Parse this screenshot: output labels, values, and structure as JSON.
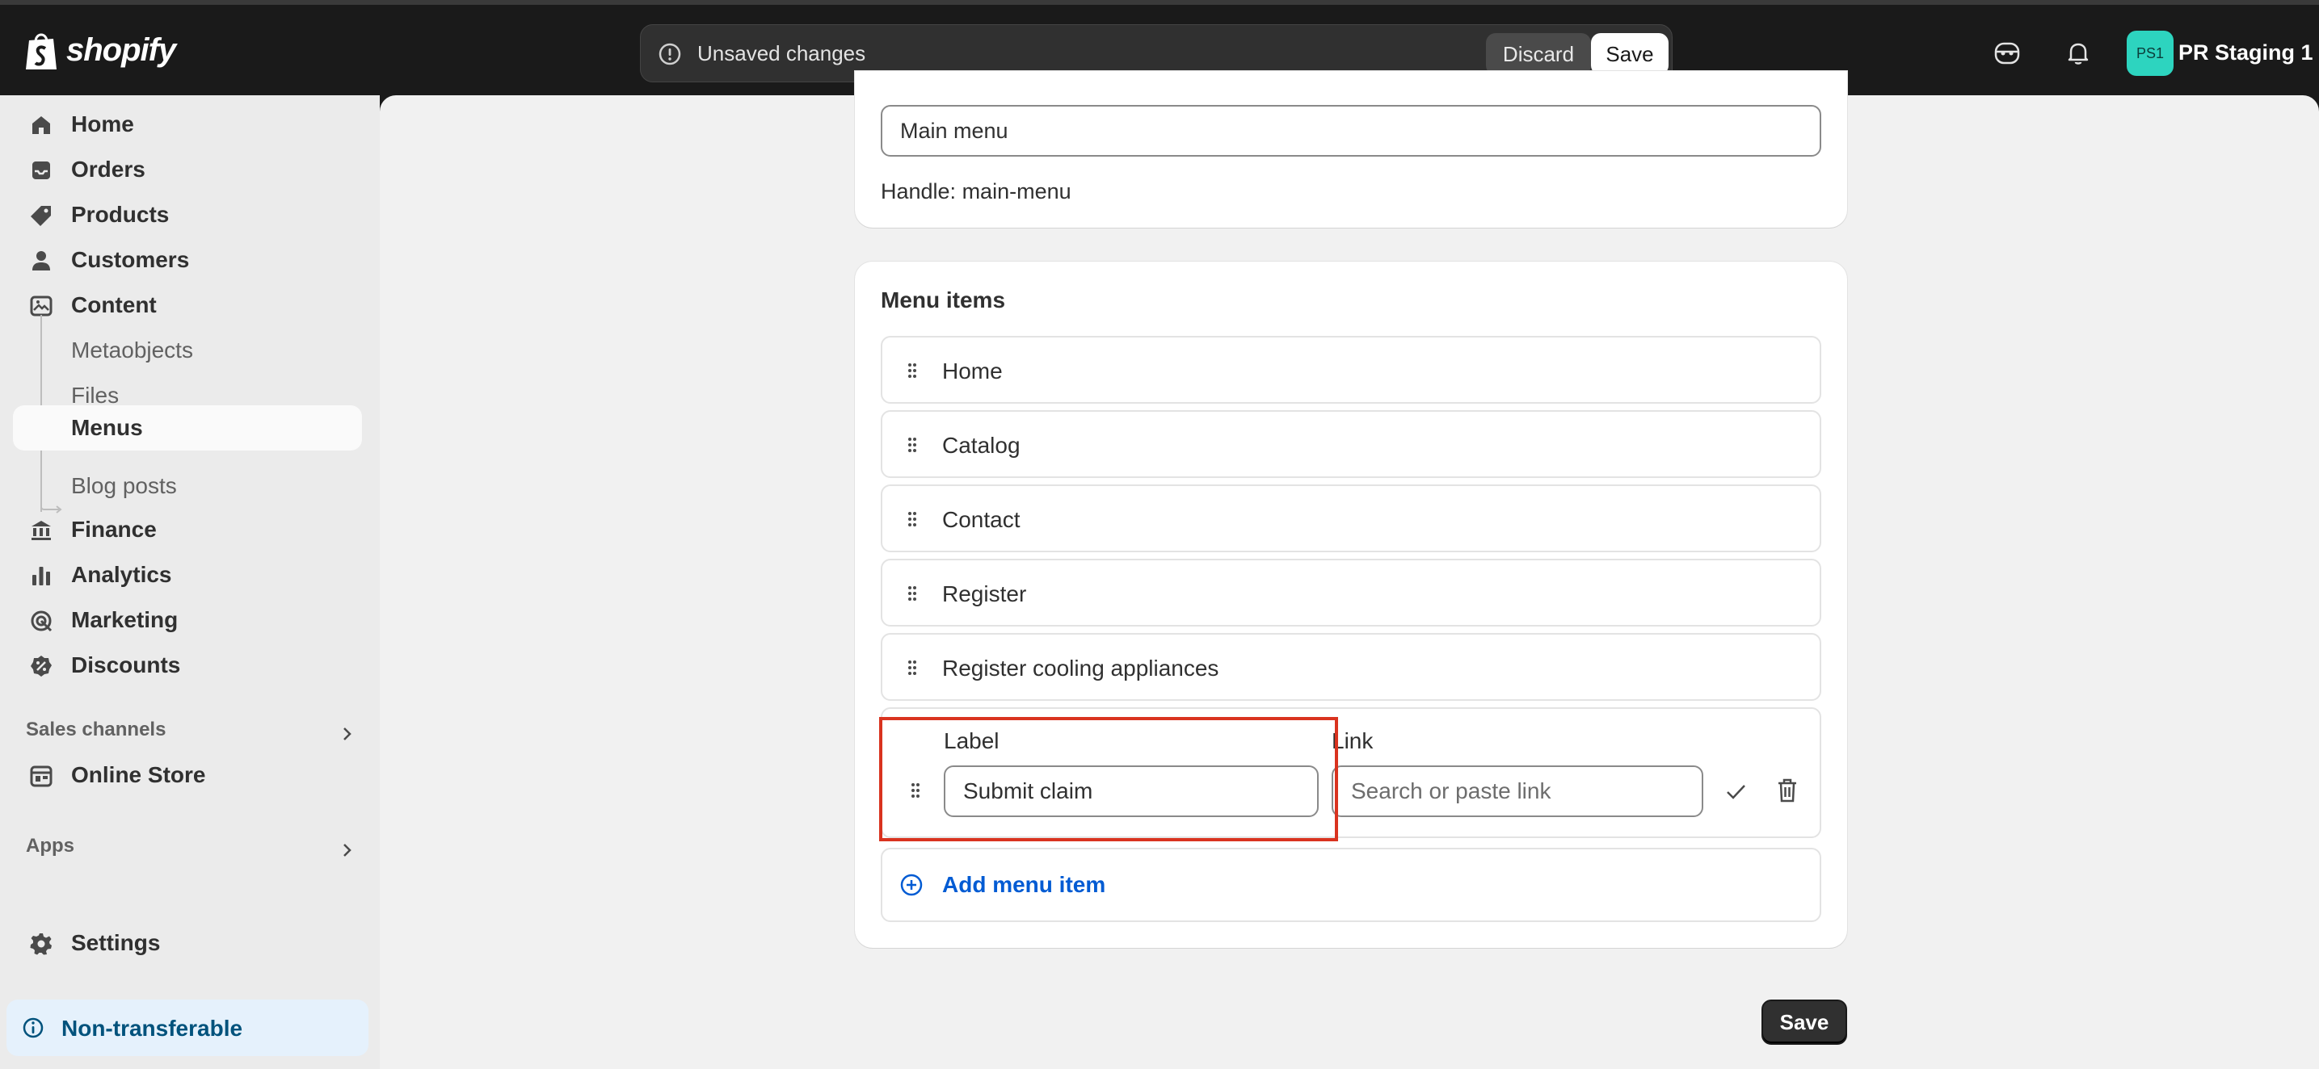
{
  "topbar": {
    "logo_text": "shopify",
    "unsaved_text": "Unsaved changes",
    "discard_label": "Discard",
    "save_label": "Save",
    "avatar_initials": "PS1",
    "store_name": "PR Staging 1",
    "avatar_color": "#2dd4bf"
  },
  "sidebar": {
    "items": [
      {
        "label": "Home",
        "icon": "home-icon"
      },
      {
        "label": "Orders",
        "icon": "inbox-icon"
      },
      {
        "label": "Products",
        "icon": "tag-icon"
      },
      {
        "label": "Customers",
        "icon": "person-icon"
      },
      {
        "label": "Content",
        "icon": "image-icon"
      }
    ],
    "content_sub": [
      "Metaobjects",
      "Files",
      "Menus",
      "Blog posts"
    ],
    "items2": [
      {
        "label": "Finance",
        "icon": "bank-icon"
      },
      {
        "label": "Analytics",
        "icon": "bar-chart-icon"
      },
      {
        "label": "Marketing",
        "icon": "target-icon"
      },
      {
        "label": "Discounts",
        "icon": "discount-icon"
      }
    ],
    "sales_channels_label": "Sales channels",
    "online_store": "Online Store",
    "apps_label": "Apps",
    "settings": "Settings",
    "notice": "Non-transferable"
  },
  "menu": {
    "title_value": "Main menu",
    "handle": "Handle: main-menu"
  },
  "menu_items": {
    "title": "Menu items",
    "items": [
      "Home",
      "Catalog",
      "Contact",
      "Register",
      "Register cooling appliances"
    ],
    "edit": {
      "label_title": "Label",
      "label_value": "Submit claim",
      "link_title": "Link",
      "link_placeholder": "Search or paste link"
    },
    "add_label": "Add menu item"
  },
  "footer": {
    "save_label": "Save"
  },
  "colors": {
    "accent": "#005bd3",
    "highlight": "#d9331f",
    "notice_bg": "#e5f1fc"
  }
}
